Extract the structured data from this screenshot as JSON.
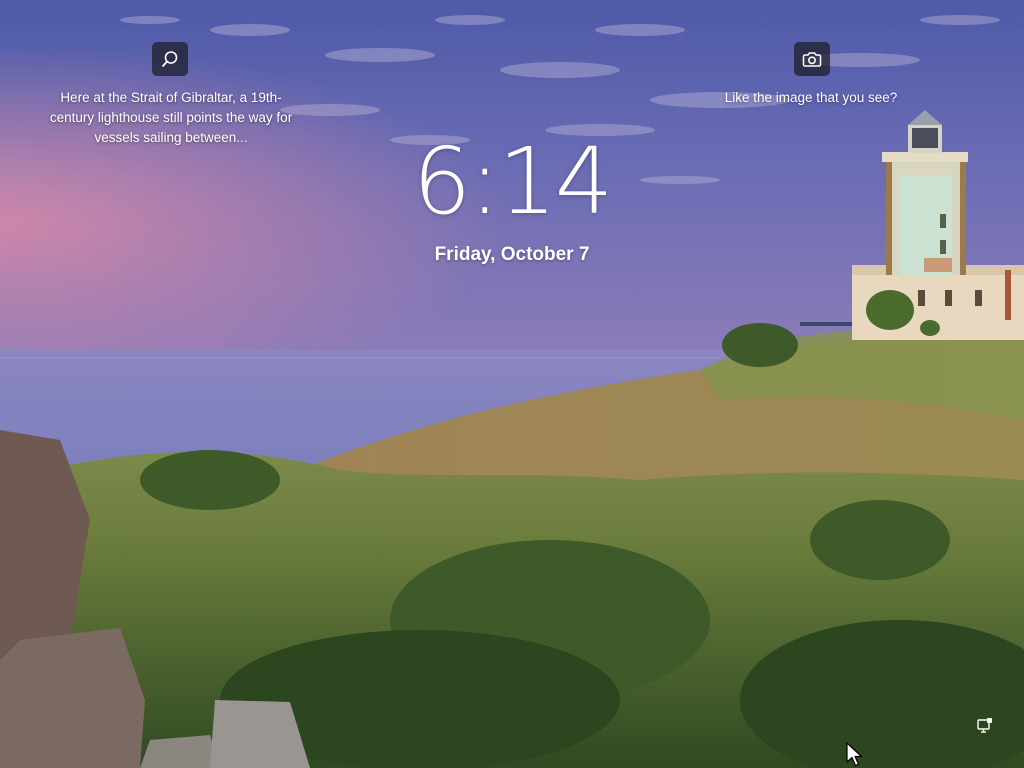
{
  "lockscreen": {
    "time": "6:14",
    "date": "Friday, October 7",
    "spotlight": {
      "description": "Here at the Strait of Gibraltar, a 19th-century lighthouse still points the way for vessels sailing between...",
      "search_icon": "search-icon",
      "feedback_prompt": "Like the image that you see?",
      "camera_icon": "camera-icon"
    },
    "status": {
      "network_icon": "network-icon"
    }
  },
  "colors": {
    "text": "#ffffff",
    "widget_bg": "#1c1c24"
  }
}
